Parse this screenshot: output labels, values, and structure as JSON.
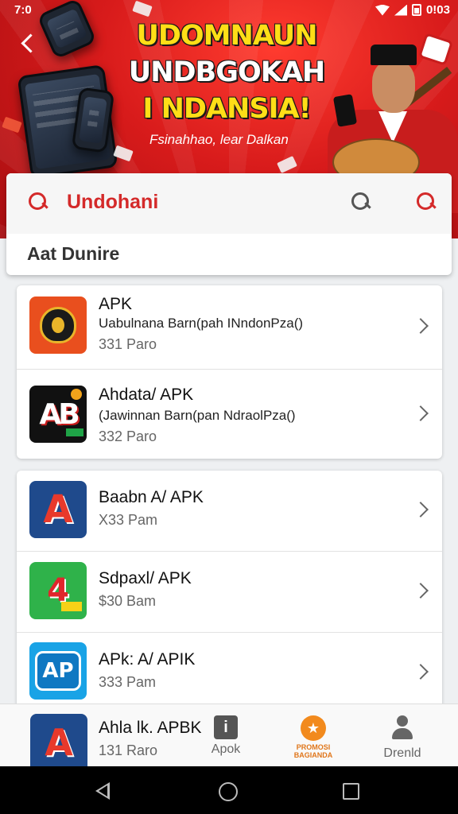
{
  "status_bar": {
    "time": "7:0",
    "right_text": "0!03"
  },
  "hero": {
    "title_line1": "UDOMNAUN",
    "title_line2": "UNDBGOKAH",
    "title_line3": "I NDANSIA!",
    "subtitle": "Fsinahhao, lear Dalkan"
  },
  "search": {
    "query": "Undohani",
    "section_label": "Aat Dunire"
  },
  "list_card_1": [
    {
      "icon": "shield-crest-icon",
      "title": "APK",
      "desc": "Uabulnana Barn(pah INndonPza()",
      "meta": "331 Paro"
    },
    {
      "icon": "ab-logo-icon",
      "title": "Ahdata/ APK",
      "desc": "(Jawinnan Barn(pan NdraolPza()",
      "meta": "332 Paro"
    }
  ],
  "list_card_2": [
    {
      "icon": "a-logo-icon",
      "title": "Baabn A/ APK",
      "meta": "X33 Pam"
    },
    {
      "icon": "a-green-logo-icon",
      "title": "Sdpaxl/ APK",
      "meta": "$30 Bam"
    },
    {
      "icon": "ap-logo-icon",
      "title": "APk: A/ APIK",
      "meta": "333 Pam"
    }
  ],
  "bottom_partial": {
    "title": "Ahla lk. APBK",
    "meta": "131 Raro"
  },
  "tabs": {
    "apok": "Apok",
    "promo": "PROMOSI BAGIANDA",
    "profile": "Drenld"
  },
  "colors": {
    "brand_red": "#d81b1b",
    "accent_red": "#d42a2a",
    "headline_yellow": "#ffde17",
    "promo_orange": "#f28a1d"
  }
}
